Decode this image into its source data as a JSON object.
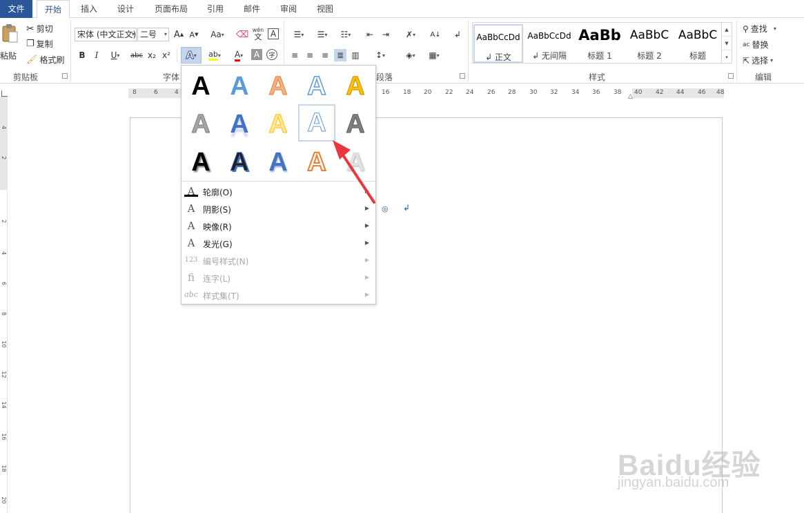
{
  "tabs": [
    "文件",
    "开始",
    "插入",
    "设计",
    "页面布局",
    "引用",
    "邮件",
    "审阅",
    "视图"
  ],
  "clipboard": {
    "paste": "粘贴",
    "cut": "剪切",
    "copy": "复制",
    "format_painter": "格式刷",
    "label": "剪贴板"
  },
  "font": {
    "family": "宋体 (中文正文)",
    "size": "二号",
    "label": "字体",
    "bold": "B",
    "italic": "I",
    "underline": "U",
    "strike": "abc",
    "subscript": "x₂",
    "superscript": "x²",
    "grow": "A",
    "shrink": "A",
    "change_case": "Aa",
    "phonetic_top": "wén",
    "phonetic_bottom": "文",
    "char_border": "A",
    "text_effects": "A",
    "font_color": "A",
    "char_shading": "A",
    "enclose": "字"
  },
  "paragraph": {
    "label": "段落"
  },
  "styles": {
    "label": "样式",
    "items": [
      {
        "sample": "AaBbCcDd",
        "name": "↲ 正文"
      },
      {
        "sample": "AaBbCcDd",
        "name": "↲ 无间隔"
      },
      {
        "sample": "AaBb",
        "name": "标题 1"
      },
      {
        "sample": "AaBbC",
        "name": "标题 2"
      },
      {
        "sample": "AaBbC",
        "name": "标题"
      }
    ]
  },
  "editing": {
    "label": "编辑",
    "find": "查找",
    "replace": "替换",
    "select": "选择"
  },
  "ruler": {
    "h_ticks": [
      "8",
      "6",
      "4",
      "16",
      "18",
      "20",
      "22",
      "24",
      "26",
      "28",
      "30",
      "32",
      "34",
      "36",
      "38",
      "40",
      "42",
      "44",
      "46",
      "48"
    ],
    "v_ticks": [
      "4",
      "2",
      "2",
      "4",
      "6",
      "8",
      "10",
      "12",
      "14",
      "16",
      "18",
      "20"
    ]
  },
  "text_effects_menu": {
    "gallery_glyph": "A",
    "items": [
      {
        "label": "轮廓(O)",
        "icon": "A",
        "disabled": false,
        "submenu": true
      },
      {
        "label": "阴影(S)",
        "icon": "A",
        "disabled": false,
        "submenu": true
      },
      {
        "label": "映像(R)",
        "icon": "A",
        "disabled": false,
        "submenu": true
      },
      {
        "label": "发光(G)",
        "icon": "A",
        "disabled": false,
        "submenu": true
      },
      {
        "label": "编号样式(N)",
        "icon": "123",
        "disabled": true,
        "submenu": true
      },
      {
        "label": "连字(L)",
        "icon": "fi",
        "disabled": true,
        "submenu": true
      },
      {
        "label": "样式集(T)",
        "icon": "abc",
        "disabled": true,
        "submenu": true
      }
    ]
  },
  "watermark": {
    "logo": "Baidu经验",
    "url": "jingyan.baidu.com"
  },
  "colors": {
    "accent": "#2b579a",
    "arrow": "#e8383d"
  }
}
